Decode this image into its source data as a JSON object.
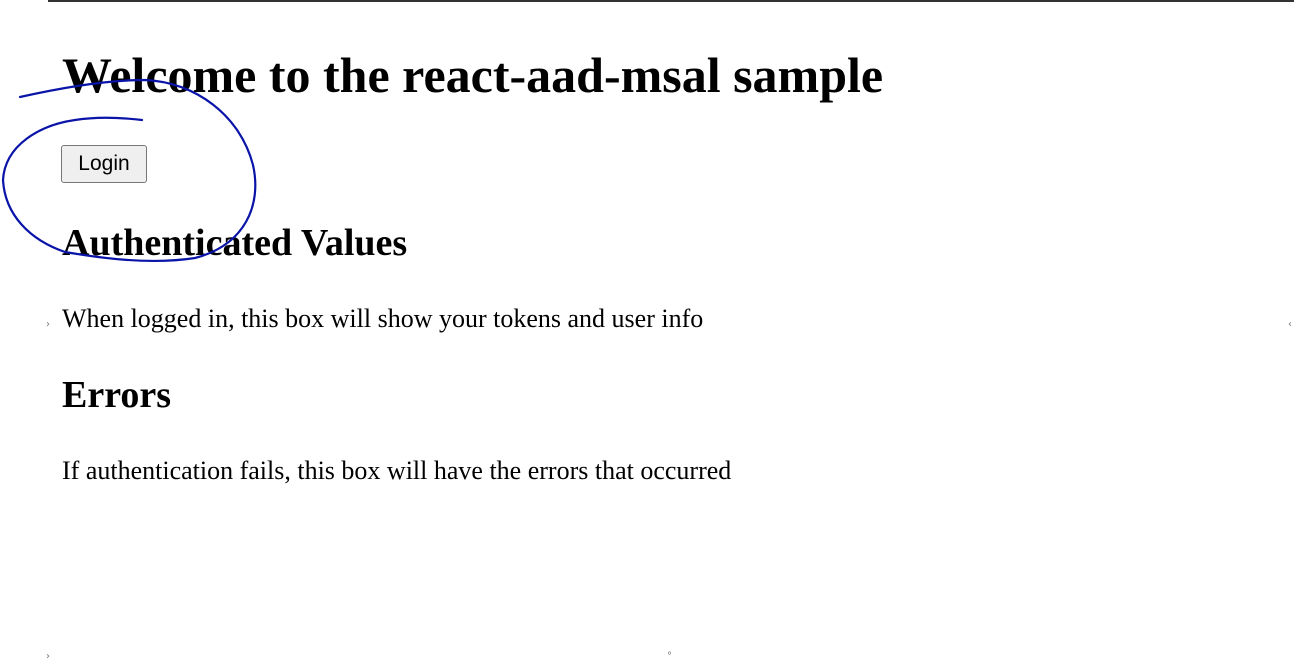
{
  "page": {
    "title": "Welcome to the react-aad-msal sample",
    "login_label": "Login"
  },
  "authenticated": {
    "heading": "Authenticated Values",
    "text": "When logged in, this box will show your tokens and user info"
  },
  "errors": {
    "heading": "Errors",
    "text": "If authentication fails, this box will have the errors that occurred"
  },
  "annotation": {
    "color": "#0a14a8",
    "shape": "hand-drawn-circle"
  }
}
